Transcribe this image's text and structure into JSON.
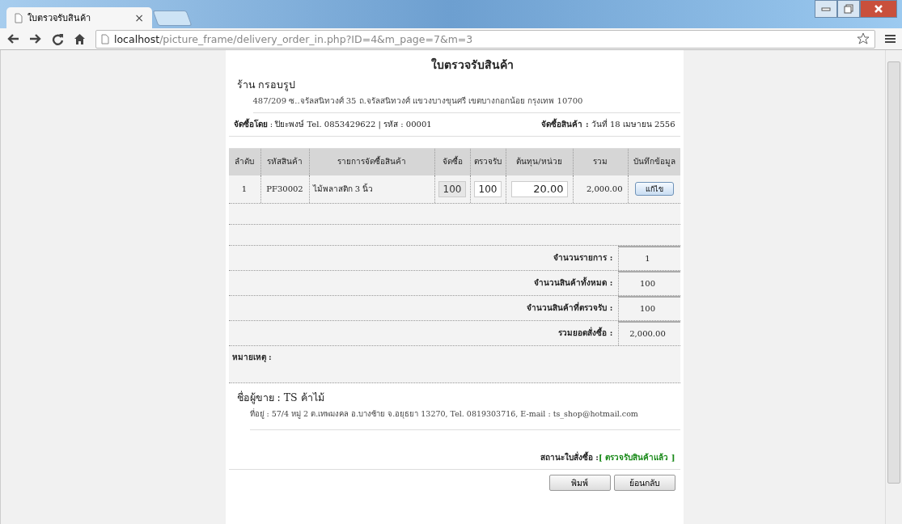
{
  "browser": {
    "tab_title": "ใบตรวจรับสินค้า",
    "tab_close": "×",
    "address": {
      "host": "localhost",
      "path": "/picture_frame/delivery_order_in.php?ID=4&m_page=7&m=3"
    }
  },
  "document": {
    "title": "ใบตรวจรับสินค้า",
    "shop_name": "ร้าน กรอบรูป",
    "shop_address": "487/209 ซ..จรัลสนิทวงศ์ 35 ถ.จรัลสนิทวงศ์ แขวงบางขุนศรี เขตบางกอกน้อย กรุงเทพ 10700",
    "buyer": "**จัดซื้อโดย** : ปิยะพงษ์ Tel. 0853429622 | รหัส : 00001",
    "order_date": "**จัดซื้อสินค้า :** วันที่ 18 เมษายน 2556",
    "table": {
      "columns": [
        "ลำดับ",
        "รหัสสินค้า",
        "รายการจัดซื้อสินค้า",
        "จัดซื้อ",
        "ตรวจรับ",
        "ต้นทุน/หน่วย",
        "รวม",
        "บันทึกข้อมูล"
      ],
      "rows": [
        {
          "no": "1",
          "code": "PF30002",
          "name": "ไม้พลาสติก 3 นิ้ว",
          "ordered": "100",
          "received": "100",
          "unit_cost": "20.00",
          "total": "2,000.00",
          "action": "แก้ไข"
        }
      ]
    },
    "summary": [
      {
        "label": "จำนวนรายการ :",
        "value": "1"
      },
      {
        "label": "จำนวนสินค้าทั้งหมด :",
        "value": "100"
      },
      {
        "label": "จำนวนสินค้าที่ตรวจรับ :",
        "value": "100"
      },
      {
        "label": "รวมยอดสั่งซื้อ :",
        "value": "2,000.00"
      }
    ],
    "remark_label": "หมายเหตุ :",
    "seller": "ชื่อผู้ขาย : TS ค้าไม้",
    "seller_address": "ที่อยู่ : 57/4 หมู่ 2 ต.เทพมงคล อ.บางซ้าย จ.อยุธยา 13270, Tel. 0819303716, E-mail : ts_shop@hotmail.com",
    "status_label": "สถานะใบสั่งซื้อ :",
    "status_value": "[ ตรวจรับสินค้าแล้ว ]",
    "buttons": [
      "พิมพ์",
      "ย้อนกลับ"
    ]
  }
}
